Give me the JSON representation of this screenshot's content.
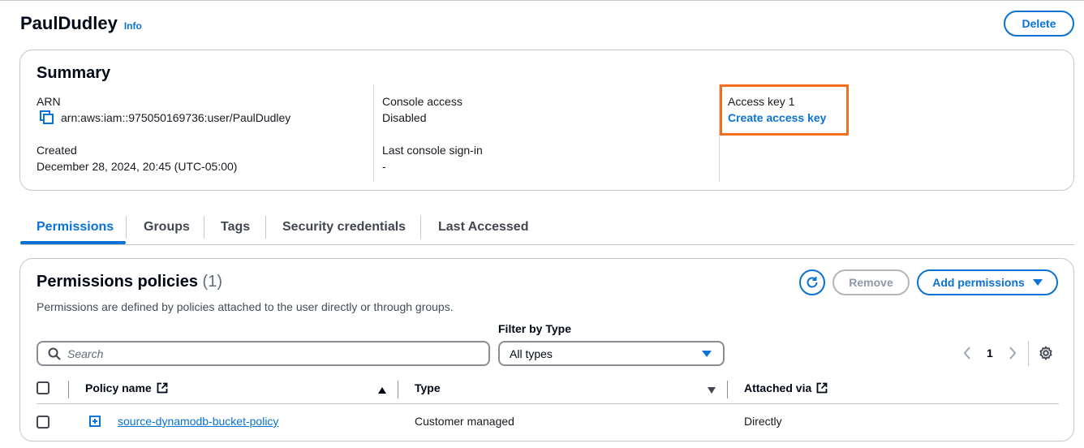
{
  "header": {
    "title": "PaulDudley",
    "info_label": "Info",
    "delete_label": "Delete"
  },
  "summary": {
    "title": "Summary",
    "arn_label": "ARN",
    "arn_value": "arn:aws:iam::975050169736:user/PaulDudley",
    "created_label": "Created",
    "created_value": "December 28, 2024, 20:45 (UTC-05:00)",
    "console_access_label": "Console access",
    "console_access_value": "Disabled",
    "last_signin_label": "Last console sign-in",
    "last_signin_value": "-",
    "access_key_label": "Access key 1",
    "create_access_key_label": "Create access key"
  },
  "tabs": [
    {
      "label": "Permissions",
      "active": true
    },
    {
      "label": "Groups",
      "active": false
    },
    {
      "label": "Tags",
      "active": false
    },
    {
      "label": "Security credentials",
      "active": false
    },
    {
      "label": "Last Accessed",
      "active": false
    }
  ],
  "permissions": {
    "title": "Permissions policies",
    "count": "(1)",
    "description": "Permissions are defined by policies attached to the user directly or through groups.",
    "remove_label": "Remove",
    "add_label": "Add permissions",
    "filter_label": "Filter by Type",
    "search_placeholder": "Search",
    "filter_value": "All types",
    "page": "1",
    "columns": [
      "Policy name",
      "Type",
      "Attached via"
    ],
    "rows": [
      {
        "policy_name": "source-dynamodb-bucket-policy",
        "type": "Customer managed",
        "attached_via": "Directly"
      }
    ]
  },
  "colors": {
    "accent": "#0972d3",
    "highlight": "#f26d1d",
    "text": "#16191f",
    "border": "#c6c6cd"
  },
  "icons": [
    "copy-icon",
    "refresh-icon",
    "caret-down-icon",
    "search-icon",
    "chevron-left-icon",
    "chevron-right-icon",
    "settings-gear-icon",
    "external-link-icon",
    "sort-ascending-icon",
    "sort-descending-icon",
    "expand-plus-icon"
  ]
}
